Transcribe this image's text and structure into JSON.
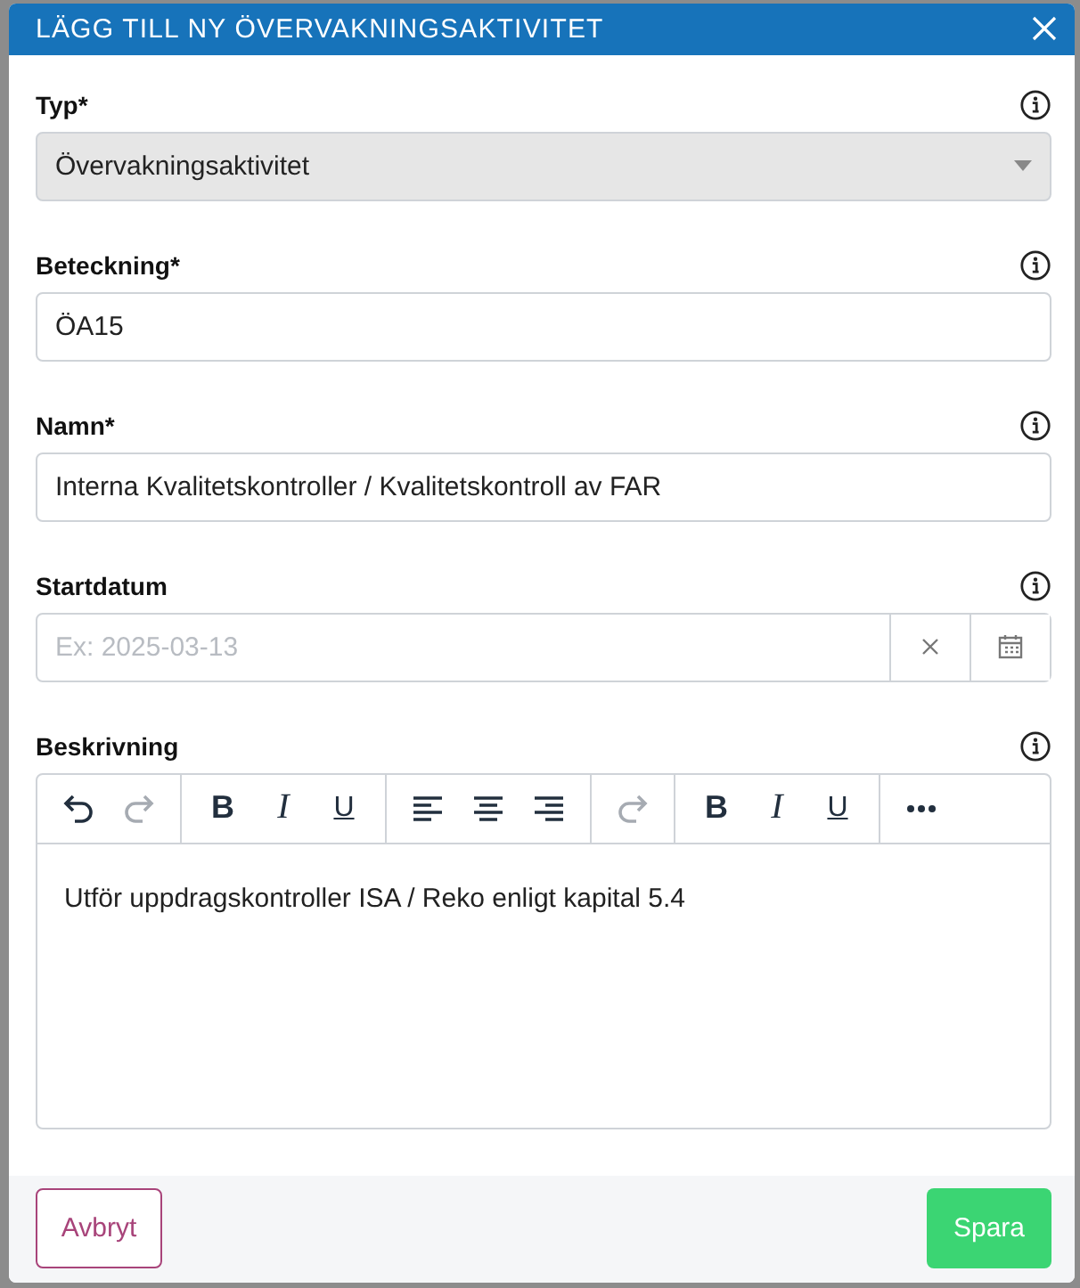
{
  "dialog": {
    "title": "LÄGG TILL NY ÖVERVAKNINGSAKTIVITET"
  },
  "fields": [
    {
      "kind": "select",
      "label": "Typ*",
      "value": "Övervakningsaktivitet",
      "disabled": true
    },
    {
      "kind": "text",
      "label": "Beteckning*",
      "value": "ÖA15"
    },
    {
      "kind": "text",
      "label": "Namn*",
      "value": "Interna Kvalitetskontroller / Kvalitetskontroll av FAR"
    },
    {
      "kind": "date",
      "label": "Startdatum",
      "placeholder": "Ex: 2025-03-13"
    },
    {
      "kind": "editor",
      "label": "Beskrivning",
      "value": "Utför uppdragskontroller ISA / Reko enligt kapital 5.4",
      "toolbar": [
        [
          {
            "kind": "undo",
            "disabled": false
          },
          {
            "kind": "redo",
            "disabled": true
          }
        ],
        [
          {
            "kind": "bold",
            "label": "B",
            "disabled": false
          },
          {
            "kind": "italic",
            "label": "I",
            "disabled": false
          },
          {
            "kind": "underline",
            "label": "U",
            "disabled": false
          }
        ],
        [
          {
            "kind": "align-left",
            "disabled": false
          },
          {
            "kind": "align-center",
            "disabled": false
          },
          {
            "kind": "align-right",
            "disabled": false
          }
        ],
        [
          {
            "kind": "redo",
            "disabled": true
          }
        ],
        [
          {
            "kind": "bold",
            "label": "B",
            "disabled": false
          },
          {
            "kind": "italic",
            "label": "I",
            "disabled": false
          },
          {
            "kind": "underline",
            "label": "U",
            "disabled": false
          }
        ],
        [
          {
            "kind": "more",
            "disabled": false
          }
        ]
      ]
    }
  ],
  "buttons": {
    "cancel": "Avbryt",
    "save": "Spara"
  }
}
